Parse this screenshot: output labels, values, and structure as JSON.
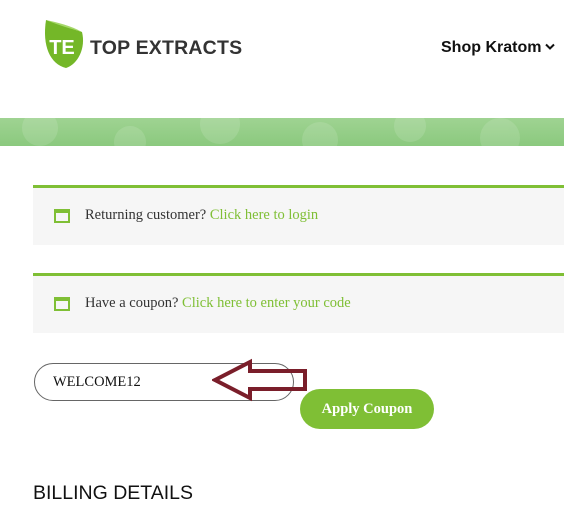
{
  "header": {
    "logo_mark": "TE",
    "logo_text": "TOP EXTRACTS",
    "nav_item": "Shop Kratom",
    "nav_icon": "chevron-down-icon"
  },
  "colors": {
    "accent_green": "#7fbf35",
    "banner_green": "#8bc97e",
    "arrow_red": "#7a1e2a",
    "notice_bg": "#f6f6f6"
  },
  "notices": [
    {
      "icon": "window-icon",
      "text": "Returning customer?",
      "link": "Click here to login"
    },
    {
      "icon": "window-icon",
      "text": "Have a coupon?",
      "link": "Click here to enter your code"
    }
  ],
  "coupon": {
    "value": "WELCOME12",
    "button_label": "Apply Coupon"
  },
  "billing": {
    "heading": "BILLING DETAILS"
  }
}
